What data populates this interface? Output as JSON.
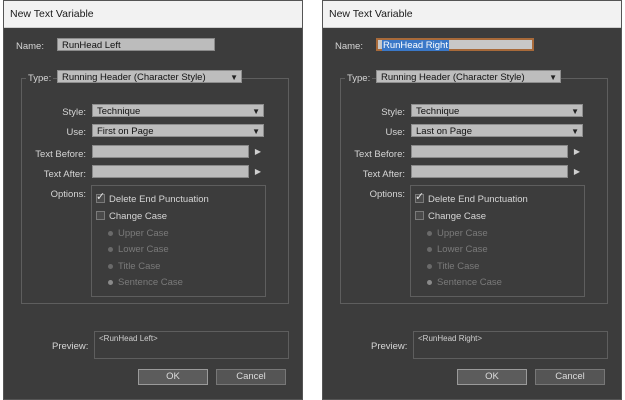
{
  "left": {
    "title": "New Text Variable",
    "name_label": "Name:",
    "name_value": "RunHead Left",
    "type_label": "Type:",
    "type_value": "Running Header (Character Style)",
    "style_label": "Style:",
    "style_value": "Technique",
    "use_label": "Use:",
    "use_value": "First on Page",
    "text_before_label": "Text Before:",
    "text_after_label": "Text After:",
    "options_label": "Options:",
    "delete_end_punct": "Delete End Punctuation",
    "change_case": "Change Case",
    "upper_case": "Upper Case",
    "lower_case": "Lower Case",
    "title_case": "Title Case",
    "sentence_case": "Sentence Case",
    "preview_label": "Preview:",
    "preview_value": "<RunHead Left>",
    "ok": "OK",
    "cancel": "Cancel"
  },
  "right": {
    "title": "New Text Variable",
    "name_label": "Name:",
    "name_value": "RunHead Right",
    "type_label": "Type:",
    "type_value": "Running Header (Character Style)",
    "style_label": "Style:",
    "style_value": "Technique",
    "use_label": "Use:",
    "use_value": "Last on Page",
    "text_before_label": "Text Before:",
    "text_after_label": "Text After:",
    "options_label": "Options:",
    "delete_end_punct": "Delete End Punctuation",
    "change_case": "Change Case",
    "upper_case": "Upper Case",
    "lower_case": "Lower Case",
    "title_case": "Title Case",
    "sentence_case": "Sentence Case",
    "preview_label": "Preview:",
    "preview_value": "<RunHead Right>",
    "ok": "OK",
    "cancel": "Cancel"
  },
  "icons": {
    "chevron": "chevron-down-icon",
    "arrow": "arrow-right-icon",
    "check": "checkmark-icon"
  }
}
